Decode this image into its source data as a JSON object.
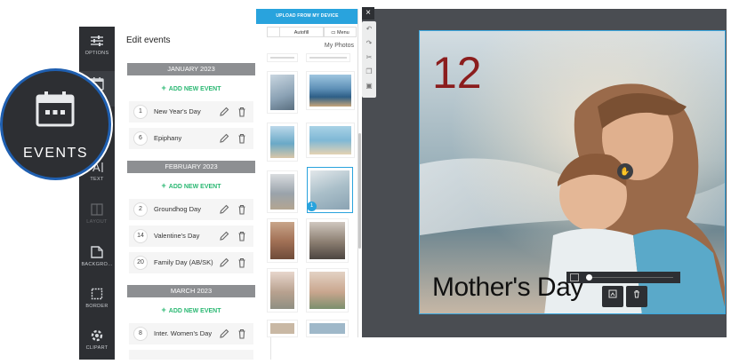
{
  "toolbar": {
    "items": [
      {
        "label": "OPTIONS",
        "icon": "sliders-icon"
      },
      {
        "label": "",
        "icon": "calendar-icon"
      },
      {
        "label": "TEXT",
        "icon": "text-icon"
      },
      {
        "label": "LAYOUT",
        "icon": "layout-icon"
      },
      {
        "label": "BACKGRO...",
        "icon": "background-icon"
      },
      {
        "label": "BORDER",
        "icon": "border-icon"
      },
      {
        "label": "CLIPART",
        "icon": "clipart-icon"
      }
    ]
  },
  "zoom_badge": {
    "label": "EVENTS",
    "icon": "calendar-icon"
  },
  "events_panel": {
    "title": "Edit events",
    "add_label": "ADD NEW EVENT",
    "months": [
      {
        "name": "JANUARY 2023",
        "events": [
          {
            "day": "1",
            "name": "New Year's Day"
          },
          {
            "day": "6",
            "name": "Epiphany"
          }
        ]
      },
      {
        "name": "FEBRUARY 2023",
        "events": [
          {
            "day": "2",
            "name": "Groundhog Day"
          },
          {
            "day": "14",
            "name": "Valentine's Day"
          },
          {
            "day": "20",
            "name": "Family Day (AB/SK)"
          }
        ]
      },
      {
        "name": "MARCH 2023",
        "events": [
          {
            "day": "8",
            "name": "Inter. Women's Day"
          }
        ]
      }
    ]
  },
  "photos_panel": {
    "upload_label": "UPLOAD FROM MY DEVICE",
    "autofill_label": "Autofill",
    "menu_label": "Menu",
    "my_photos_label": "My Photos",
    "selected_badge": "1"
  },
  "canvas": {
    "day_number": "12",
    "caption": "Mother's Day",
    "close_label": "×",
    "accent": "#3aa8e0",
    "number_color": "#8b1d1d"
  }
}
